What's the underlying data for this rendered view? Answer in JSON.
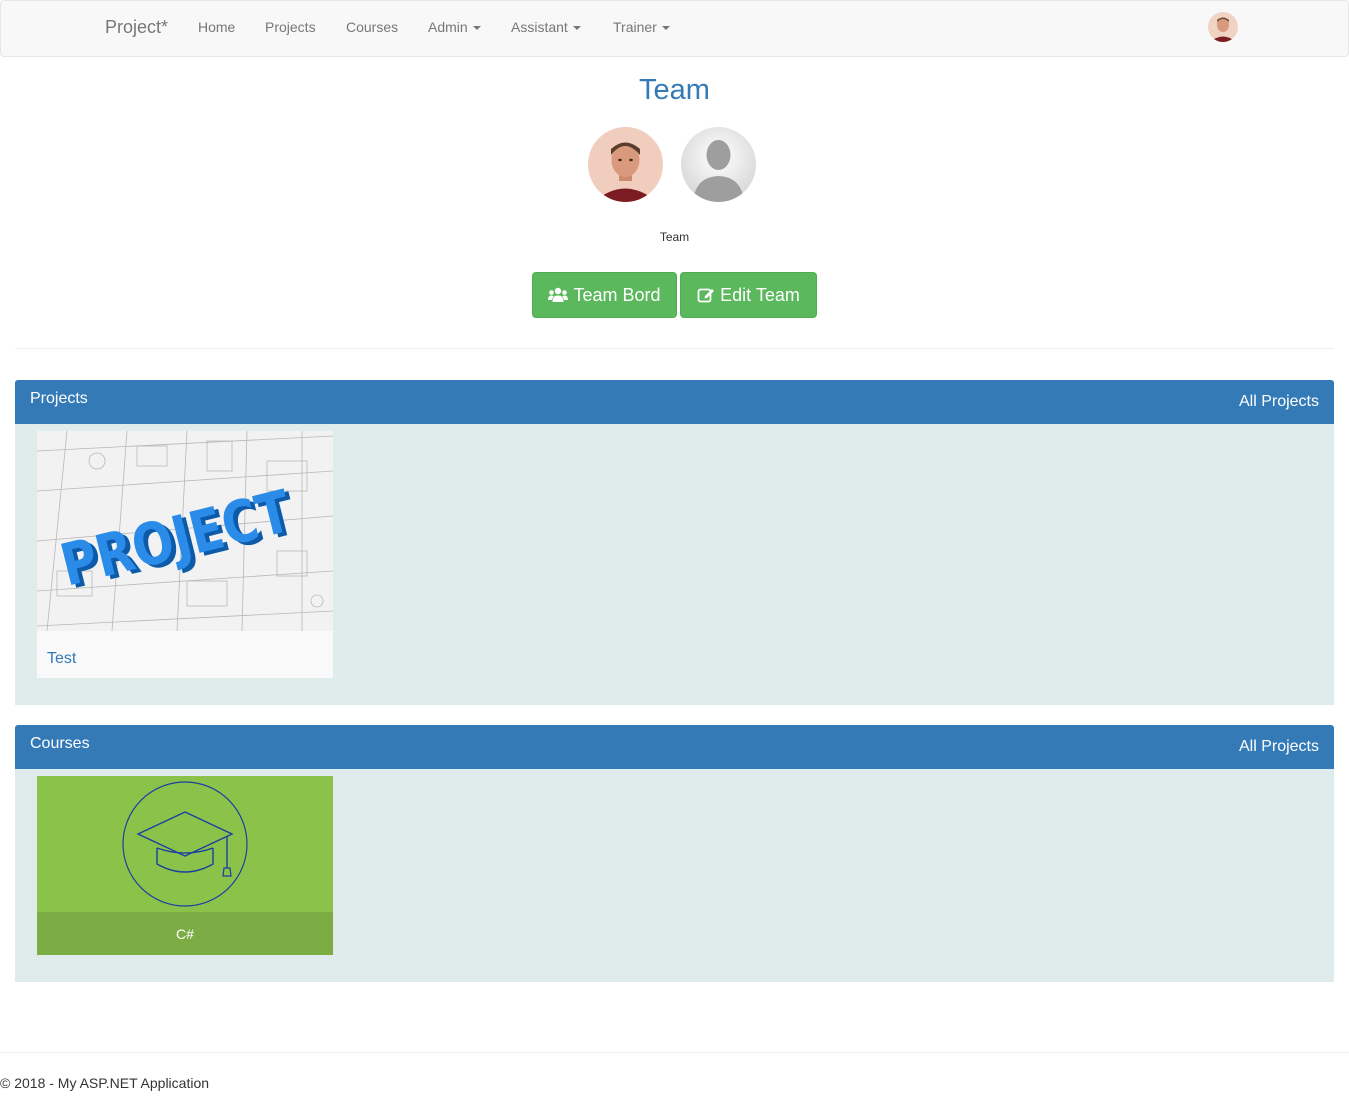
{
  "navbar": {
    "brand": "Project*",
    "items": [
      {
        "label": "Home",
        "dropdown": false
      },
      {
        "label": "Projects",
        "dropdown": false
      },
      {
        "label": "Courses",
        "dropdown": false
      },
      {
        "label": "Admin",
        "dropdown": true
      },
      {
        "label": "Assistant",
        "dropdown": true
      },
      {
        "label": "Trainer",
        "dropdown": true
      }
    ],
    "avatar_icon": "user-avatar-icon"
  },
  "team": {
    "title": "Team",
    "label": "Team",
    "members": [
      {
        "icon": "member-photo-icon"
      },
      {
        "icon": "default-user-silhouette-icon"
      }
    ],
    "buttons": {
      "team_board": "Team Bord",
      "edit_team": "Edit Team"
    }
  },
  "projects_panel": {
    "title": "Projects",
    "link": "All Projects",
    "items": [
      {
        "name": "Test",
        "thumb_text": "PROJECT"
      }
    ]
  },
  "courses_panel": {
    "title": "Courses",
    "link": "All Projects",
    "items": [
      {
        "name": "C#",
        "icon": "graduation-cap-icon"
      }
    ]
  },
  "footer": {
    "text": "© 2018 - My ASP.NET Application"
  },
  "colors": {
    "primary": "#337ab7",
    "success": "#5cb85c",
    "panel_bg": "#e0ecec",
    "course_green": "#8bc34a"
  }
}
